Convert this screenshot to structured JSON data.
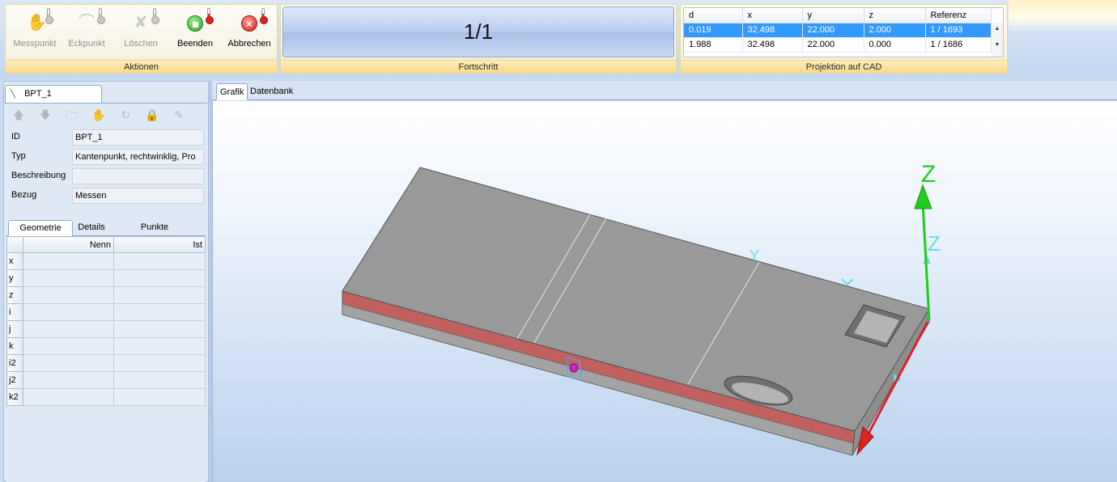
{
  "ribbon": {
    "actions": {
      "caption": "Aktionen",
      "buttons": [
        {
          "label": "Messpunkt",
          "icon": "hand-icon",
          "enabled": false
        },
        {
          "label": "Eckpunkt",
          "icon": "corner-point-icon",
          "enabled": false
        },
        {
          "label": "Löschen",
          "icon": "delete-icon",
          "enabled": false
        },
        {
          "label": "Beenden",
          "icon": "stop-icon",
          "enabled": true
        },
        {
          "label": "Abbrechen",
          "icon": "cancel-icon",
          "enabled": true
        }
      ]
    },
    "progress": {
      "caption": "Fortschritt",
      "value": "1/1"
    },
    "projection": {
      "caption": "Projektion auf CAD",
      "columns": [
        "d",
        "x",
        "y",
        "z",
        "Referenz"
      ],
      "rows": [
        [
          "0.019",
          "32.498",
          "22.000",
          "2.000",
          "1 / 1693"
        ],
        [
          "1.988",
          "32.498",
          "22.000",
          "0.000",
          "1 / 1686"
        ]
      ],
      "selected_row": 0
    }
  },
  "object_panel": {
    "tab_label": "BPT_1",
    "fields": [
      {
        "label": "ID",
        "value": "BPT_1"
      },
      {
        "label": "Typ",
        "value": "Kantenpunkt, rechtwinklig, Pro"
      },
      {
        "label": "Beschreibung",
        "value": ""
      },
      {
        "label": "Bezug",
        "value": "Messen"
      }
    ],
    "sub_tabs": [
      "Geometrie",
      "Details",
      "Punkte"
    ],
    "geometry": {
      "columns": [
        "Nenn",
        "Ist"
      ],
      "rows": [
        "x",
        "y",
        "z",
        "i",
        "j",
        "k",
        "i2",
        "j2",
        "k2"
      ]
    }
  },
  "view": {
    "tabs": [
      "Grafik",
      "Datenbank"
    ],
    "axes": {
      "z_label": "Z",
      "z2_label": "Z",
      "y_label": "Y"
    },
    "colors": {
      "part": "#999999",
      "edge_face": "#c0605f",
      "z_axis": "#22cc22",
      "aux_axis": "#66ddee",
      "x_axis": "#dd2222",
      "probe": "#cc22cc"
    }
  }
}
